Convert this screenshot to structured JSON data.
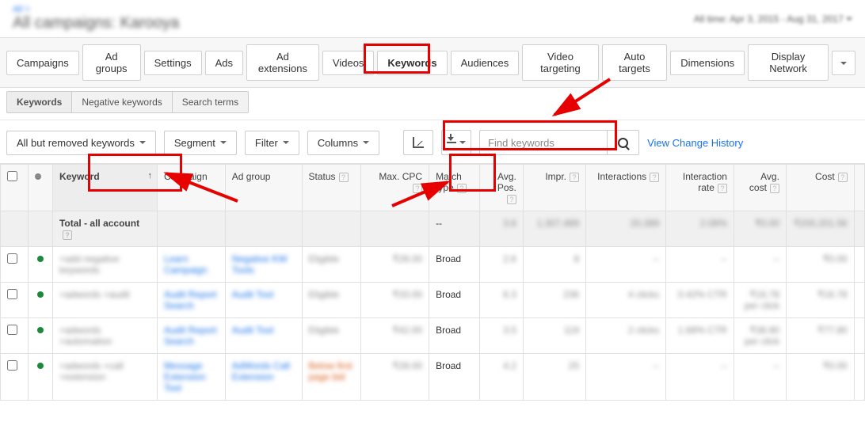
{
  "header": {
    "breadcrumb": "All >",
    "title": "All campaigns: Karooya",
    "dateRange": "All time: Apr 3, 2015 - Aug 31, 2017"
  },
  "mainTabs": [
    {
      "label": "Campaigns",
      "key": "campaigns"
    },
    {
      "label": "Ad groups",
      "key": "adgroups"
    },
    {
      "label": "Settings",
      "key": "settings"
    },
    {
      "label": "Ads",
      "key": "ads"
    },
    {
      "label": "Ad extensions",
      "key": "adext"
    },
    {
      "label": "Videos",
      "key": "videos"
    },
    {
      "label": "Keywords",
      "key": "keywords",
      "active": true
    },
    {
      "label": "Audiences",
      "key": "audiences"
    },
    {
      "label": "Video targeting",
      "key": "videotarg"
    },
    {
      "label": "Auto targets",
      "key": "autotarg"
    },
    {
      "label": "Dimensions",
      "key": "dimensions"
    },
    {
      "label": "Display Network",
      "key": "display"
    }
  ],
  "subTabs": [
    {
      "label": "Keywords",
      "active": true
    },
    {
      "label": "Negative keywords"
    },
    {
      "label": "Search terms"
    }
  ],
  "toolbar": {
    "filterScope": "All but removed keywords",
    "segment": "Segment",
    "filter": "Filter",
    "columns": "Columns",
    "searchPlaceholder": "Find keywords",
    "changeHistory": "View Change History"
  },
  "columns": [
    {
      "label": "Keyword",
      "sorted": "asc"
    },
    {
      "label": "Campaign"
    },
    {
      "label": "Ad group"
    },
    {
      "label": "Status",
      "help": true
    },
    {
      "label": "Max. CPC",
      "help": true,
      "align": "right"
    },
    {
      "label": "Match type",
      "help": true
    },
    {
      "label": "Avg. Pos.",
      "help": true,
      "align": "right"
    },
    {
      "label": "Impr.",
      "help": true,
      "align": "right"
    },
    {
      "label": "Interactions",
      "help": true,
      "align": "right"
    },
    {
      "label": "Interaction rate",
      "help": true,
      "align": "right"
    },
    {
      "label": "Avg. cost",
      "help": true,
      "align": "right"
    },
    {
      "label": "Cost",
      "help": true,
      "align": "right"
    }
  ],
  "totalRow": {
    "label": "Total - all account",
    "match": "--",
    "pos": "3.6",
    "impr": "1,307,489",
    "inter": "20,389",
    "rate": "2.08%",
    "avgcost": "₹0.00",
    "cost": "₹200,201.56"
  },
  "rows": [
    {
      "kw": "+add negative keywords",
      "camp": "Learn Campaign",
      "adg": "Negative KW Tools",
      "status": "Eligible",
      "cpc": "₹28.00",
      "match": "Broad",
      "pos": "2.6",
      "impr": "8",
      "inter": "--",
      "rate": "--",
      "avgcost": "--",
      "cost": "₹0.00"
    },
    {
      "kw": "+adwords +audit",
      "camp": "Audit Report Search",
      "adg": "Audit Tool",
      "status": "Eligible",
      "cpc": "₹33.00",
      "match": "Broad",
      "pos": "6.3",
      "impr": "236",
      "inter": "4 clicks",
      "rate": "0.42% CTR",
      "avgcost": "₹16.78 per click",
      "cost": "₹16.78"
    },
    {
      "kw": "+adwords +automation",
      "camp": "Audit Report Search",
      "adg": "Audit Tool",
      "status": "Eligible",
      "cpc": "₹42.00",
      "match": "Broad",
      "pos": "3.5",
      "impr": "119",
      "inter": "2 clicks",
      "rate": "1.68% CTR",
      "avgcost": "₹38.90 per click",
      "cost": "₹77.80"
    },
    {
      "kw": "+adwords +call +extension",
      "camp": "Message Extension Tool",
      "adg": "AdWords Call Extension",
      "status": "Below first page bid",
      "cpc": "₹28.00",
      "match": "Broad",
      "pos": "4.2",
      "impr": "25",
      "inter": "--",
      "rate": "--",
      "avgcost": "--",
      "cost": "₹0.00"
    }
  ]
}
